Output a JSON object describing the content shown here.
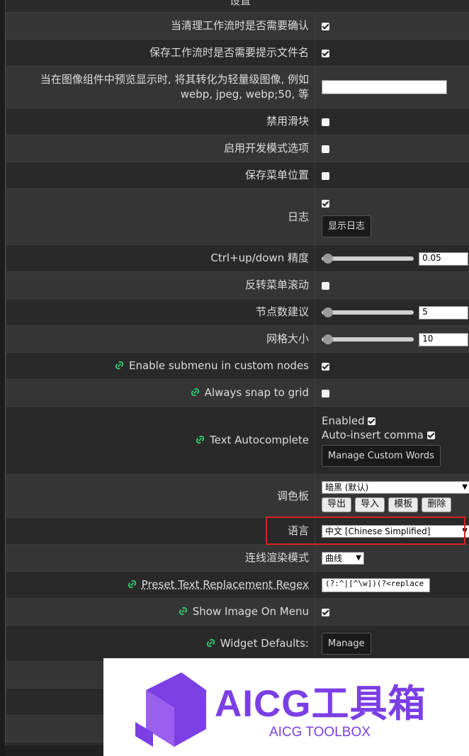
{
  "dialog": {
    "title": "设置"
  },
  "rows": {
    "confirm_clear": {
      "label": "当清理工作流时是否需要确认",
      "checked": true
    },
    "prompt_filename": {
      "label": "保存工作流时是否需要提示文件名",
      "checked": true
    },
    "preview_format": {
      "label_line1": "当在图像组件中预览显示时, 将其转化为轻量级图像, 例如",
      "label_line2": "webp, jpeg, webp;50, 等",
      "value": ""
    },
    "disable_slider": {
      "label": "禁用滑块",
      "checked": false
    },
    "dev_mode": {
      "label": "启用开发模式选项",
      "checked": false
    },
    "save_menu_pos": {
      "label": "保存菜单位置",
      "checked": false
    },
    "log": {
      "label": "日志",
      "checked": true,
      "button": "显示日志"
    },
    "ctrl_precision": {
      "label": "Ctrl+up/down 精度",
      "value": "0.05"
    },
    "invert_menu_scroll": {
      "label": "反转菜单滚动",
      "checked": false
    },
    "node_suggestions": {
      "label": "节点数建议",
      "value": "5"
    },
    "grid_size": {
      "label": "网格大小",
      "value": "10"
    },
    "submenu": {
      "label": "Enable submenu in custom nodes",
      "checked": true
    },
    "snap_grid": {
      "label": "Always snap to grid",
      "checked": false
    },
    "autocomplete": {
      "label": "Text Autocomplete",
      "enabled_label": "Enabled",
      "enabled": true,
      "comma_label": "Auto-insert comma",
      "comma": true,
      "button": "Manage Custom Words"
    },
    "palette": {
      "label": "调色板",
      "selected": "暗黑 (默认)",
      "buttons": [
        "导出",
        "导入",
        "模板",
        "删除"
      ]
    },
    "language": {
      "label": "语言",
      "selected": "中文 [Chinese Simplified]"
    },
    "link_render": {
      "label": "连线渲染模式",
      "selected": "曲线"
    },
    "preset_regex": {
      "label": "Preset Text Replacement Regex",
      "value": "(?:^|[^\\w])(?<replace"
    },
    "show_image_menu": {
      "label": "Show Image On Menu",
      "checked": true
    },
    "widget_defaults": {
      "label": "Widget Defaults:",
      "button": "Manage"
    }
  },
  "watermark": {
    "title": "AICG工具箱",
    "subtitle": "AICG TOOLBOX"
  },
  "colors": {
    "accent_icon": "#2ecc71",
    "highlight_box": "#d92020",
    "watermark": "#7b3fe4"
  }
}
